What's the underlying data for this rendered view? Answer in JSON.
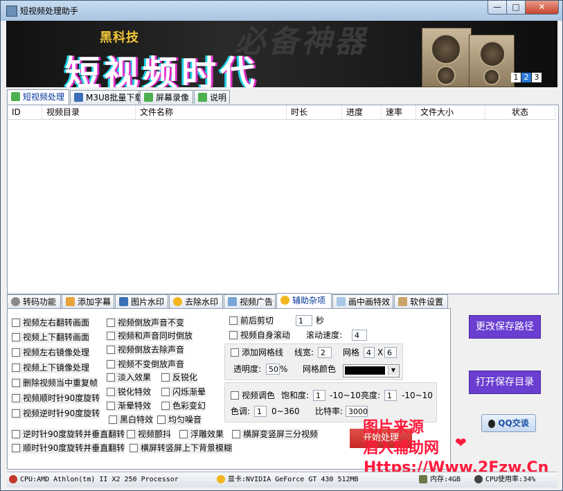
{
  "window": {
    "title": "短视频处理助手",
    "minimize": "—",
    "maximize": "□",
    "close": "✕"
  },
  "banner": {
    "subtitle": "黑科技",
    "title": "短视频时代",
    "watermark": "必备神器",
    "pages": [
      "1",
      "2",
      "3"
    ],
    "active_page": "2"
  },
  "top_tabs": [
    {
      "label": "短视频处理",
      "icon": "video-icon",
      "active": true
    },
    {
      "label": "M3U8批量下载",
      "icon": "download-grid-icon",
      "active": false
    },
    {
      "label": "屏幕录像",
      "icon": "record-icon",
      "active": false
    },
    {
      "label": "说明",
      "icon": "info-icon",
      "active": false
    }
  ],
  "table": {
    "columns": [
      "ID",
      "视频目录",
      "文件名称",
      "时长",
      "进度",
      "速率",
      "文件大小",
      "状态"
    ]
  },
  "bottom_tabs": [
    {
      "label": "转码功能",
      "active": false
    },
    {
      "label": "添加字幕",
      "active": false
    },
    {
      "label": "图片水印",
      "active": false
    },
    {
      "label": "去除水印",
      "active": false
    },
    {
      "label": "视频广告",
      "active": false
    },
    {
      "label": "辅助杂项",
      "active": true
    },
    {
      "label": "画中画特效",
      "active": false
    },
    {
      "label": "软件设置",
      "active": false
    }
  ],
  "options": {
    "col1": [
      "视频左右翻转画面",
      "视频上下翻转画面",
      "视频左右镜像处理",
      "视频上下镜像处理",
      "删除视频当中重复帧",
      "视频顺时针90度旋转",
      "视频逆时针90度旋转"
    ],
    "col2": [
      "视频倒放声音不变",
      "视频和声音同时倒放",
      "视频倒放去除声音",
      "视频不变倒放声音"
    ],
    "col2_pairs": [
      [
        "淡入效果",
        "反锐化"
      ],
      [
        "锐化特效",
        "闪烁渐晕"
      ],
      [
        "渐晕特效",
        "色彩变幻"
      ]
    ],
    "row_extra": [
      "黑白特效",
      "均匀噪音"
    ],
    "bottom_row1": [
      "逆时针90度旋转并垂直翻转",
      "视频颤抖",
      "浮雕效果",
      "横屏变竖屏三分视频"
    ],
    "bottom_row2": [
      "顺时针90度旋转并垂直翻转",
      "横屏转竖屏上下背景模糊"
    ]
  },
  "trim": {
    "label": "前后剪切",
    "value": "1",
    "unit": "秒"
  },
  "scroll": {
    "label": "视频自身滚动",
    "speed_label": "滚动速度:",
    "speed_value": "4"
  },
  "grid": {
    "label": "添加网格线",
    "width_label": "线宽:",
    "width_value": "2",
    "grid_label": "网格",
    "rows": "4",
    "x": "X",
    "cols": "6",
    "opacity_label": "透明度:",
    "opacity_value": "50",
    "opacity_unit": "%",
    "color_label": "网格颜色",
    "color": "#000000"
  },
  "color_adjust": {
    "label": "视频调色",
    "saturation_label": "饱和度:",
    "saturation_value": "1",
    "saturation_range": "-10~10",
    "brightness_label": "亮度:",
    "brightness_value": "1",
    "brightness_range": "-10~10",
    "hue_label": "色调:",
    "hue_value": "1",
    "hue_range": "0~360",
    "bitrate_label": "比特率:",
    "bitrate_value": "3000"
  },
  "start_button": "开始处理",
  "side_buttons": {
    "change_path": "更改保存路径",
    "open_dir": "打开保存目录",
    "qq": "QQ交谈"
  },
  "overlay_watermark": {
    "line1": "图片来源",
    "line2": "酒入辅助网",
    "line3": "Https://Www.2Fzw.Cn"
  },
  "status": {
    "cpu": "CPU:AMD Athlon(tm) II X2 250 Processor",
    "gpu": "显卡:NVIDIA GeForce GT 430  512MB",
    "memory": "内存:4GB",
    "cpu_usage": "CPU使用率:34%"
  }
}
